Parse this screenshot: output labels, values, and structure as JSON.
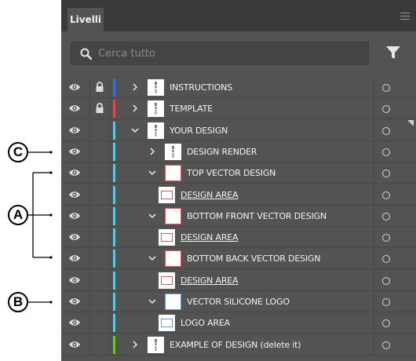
{
  "panel": {
    "tab_label": "Livelli",
    "search_placeholder": "Cerca tutto"
  },
  "layers": [
    {
      "name": "INSTRUCTIONS",
      "color": "#3b6fd8",
      "locked": true,
      "expanded": false,
      "indent": 0,
      "thumb": "art",
      "underline": false
    },
    {
      "name": "TEMPLATE",
      "color": "#e04848",
      "locked": true,
      "expanded": false,
      "indent": 0,
      "thumb": "art",
      "underline": false
    },
    {
      "name": "YOUR DESIGN",
      "color": "#5cc8e0",
      "locked": false,
      "expanded": true,
      "indent": 0,
      "thumb": "art",
      "underline": false
    },
    {
      "name": "DESIGN RENDER",
      "color": "#5cc8e0",
      "locked": false,
      "expanded": false,
      "indent": 1,
      "thumb": "art",
      "underline": false
    },
    {
      "name": "TOP VECTOR DESIGN",
      "color": "#5cc8e0",
      "locked": false,
      "expanded": true,
      "indent": 1,
      "thumb": "red-frame",
      "underline": false
    },
    {
      "name": "DESIGN AREA",
      "color": "#5cc8e0",
      "locked": false,
      "expanded": null,
      "indent": 2,
      "thumb": "red-inner",
      "underline": true
    },
    {
      "name": "BOTTOM FRONT VECTOR DESIGN",
      "color": "#5cc8e0",
      "locked": false,
      "expanded": true,
      "indent": 1,
      "thumb": "red-frame",
      "underline": false
    },
    {
      "name": "DESIGN AREA",
      "color": "#5cc8e0",
      "locked": false,
      "expanded": null,
      "indent": 2,
      "thumb": "red-inner",
      "underline": true
    },
    {
      "name": "BOTTOM BACK VECTOR DESIGN",
      "color": "#5cc8e0",
      "locked": false,
      "expanded": true,
      "indent": 1,
      "thumb": "red-frame",
      "underline": false
    },
    {
      "name": "DESIGN AREA",
      "color": "#5cc8e0",
      "locked": false,
      "expanded": null,
      "indent": 2,
      "thumb": "red-inner",
      "underline": true
    },
    {
      "name": "VECTOR SILICONE LOGO",
      "color": "#5cc8e0",
      "locked": false,
      "expanded": true,
      "indent": 1,
      "thumb": "blue-frame",
      "underline": false
    },
    {
      "name": "LOGO AREA",
      "color": "#5cc8e0",
      "locked": false,
      "expanded": null,
      "indent": 2,
      "thumb": "blue-inner",
      "underline": false
    },
    {
      "name": "EXAMPLE OF DESIGN (delete it)",
      "color": "#6ec23a",
      "locked": false,
      "expanded": false,
      "indent": 0,
      "thumb": "art",
      "underline": false
    }
  ],
  "annotations": {
    "a_label": "A",
    "b_label": "B",
    "c_label": "C"
  },
  "icons": {
    "visibility": "eye-icon",
    "lock": "lock-icon",
    "search": "search-icon",
    "filter": "filter-icon",
    "menu": "panel-menu-icon",
    "target": "target-circle-icon"
  }
}
